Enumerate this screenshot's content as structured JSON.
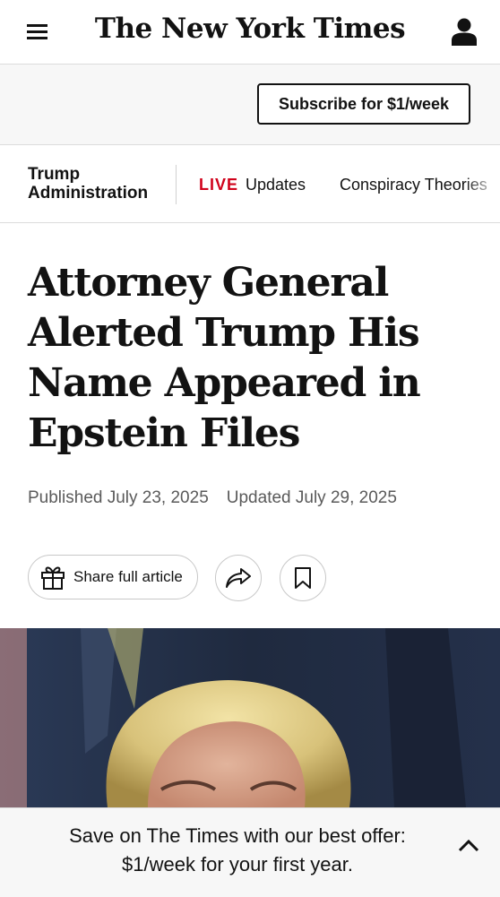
{
  "masthead": {
    "logo_text": "The New York Times",
    "menu_icon": "hamburger-menu-icon",
    "account_icon": "account-icon"
  },
  "subscribe": {
    "label": "Subscribe for $1/week"
  },
  "section_nav": {
    "section_title": "Trump Administration",
    "live_tag": "LIVE",
    "live_label": "Updates",
    "link_label": "Conspiracy Theories",
    "live_color": "#d0021b"
  },
  "article": {
    "headline": "Attorney General Alerted Trump His Name Appeared in Epstein Files",
    "published": "Published July 23, 2025",
    "updated": "Updated July 29, 2025",
    "share_label": "Share full article",
    "share_icon": "gift-icon",
    "forward_icon": "share-arrow-icon",
    "save_icon": "bookmark-icon"
  },
  "offer_banner": {
    "line1": "Save on The Times with our best offer:",
    "line2": "$1/week for your first year.",
    "toggle_icon": "chevron-up-icon"
  }
}
